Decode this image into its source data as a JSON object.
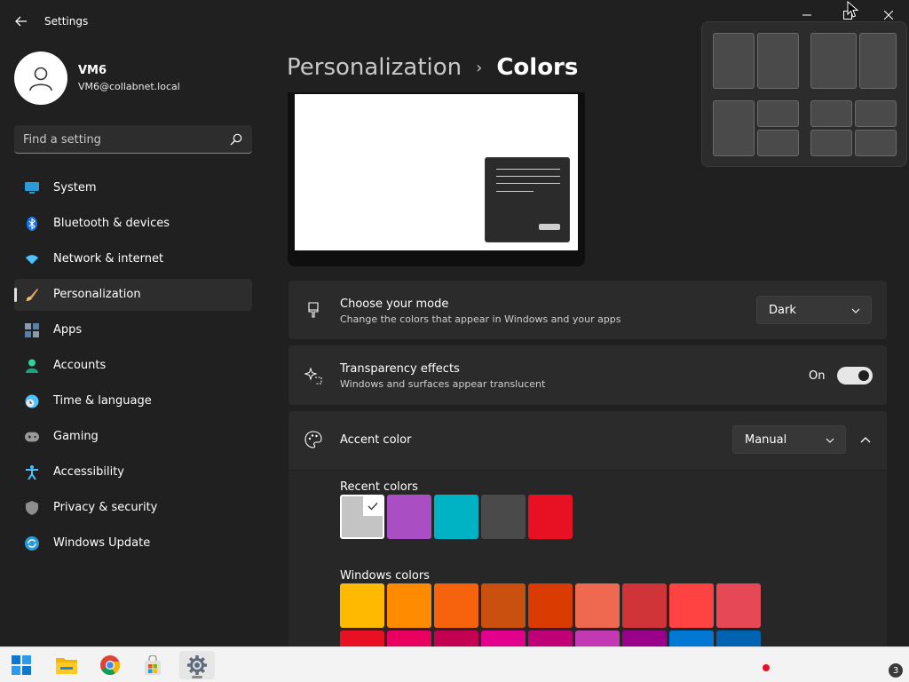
{
  "window": {
    "title": "Settings"
  },
  "user": {
    "name": "VM6",
    "email": "VM6@collabnet.local"
  },
  "search": {
    "placeholder": "Find a setting"
  },
  "sidebar": {
    "items": [
      {
        "label": "System",
        "icon": "monitor-icon",
        "active": false
      },
      {
        "label": "Bluetooth & devices",
        "icon": "bluetooth-icon",
        "active": false
      },
      {
        "label": "Network & internet",
        "icon": "wifi-icon",
        "active": false
      },
      {
        "label": "Personalization",
        "icon": "brush-icon",
        "active": true
      },
      {
        "label": "Apps",
        "icon": "apps-icon",
        "active": false
      },
      {
        "label": "Accounts",
        "icon": "person-icon",
        "active": false
      },
      {
        "label": "Time & language",
        "icon": "clock-globe-icon",
        "active": false
      },
      {
        "label": "Gaming",
        "icon": "gamepad-icon",
        "active": false
      },
      {
        "label": "Accessibility",
        "icon": "accessibility-icon",
        "active": false
      },
      {
        "label": "Privacy & security",
        "icon": "shield-icon",
        "active": false
      },
      {
        "label": "Windows Update",
        "icon": "update-icon",
        "active": false
      }
    ]
  },
  "breadcrumb": {
    "parent": "Personalization",
    "separator": "›",
    "current": "Colors"
  },
  "mode": {
    "title": "Choose your mode",
    "desc": "Change the colors that appear in Windows and your apps",
    "value": "Dark"
  },
  "transparency": {
    "title": "Transparency effects",
    "desc": "Windows and surfaces appear translucent",
    "state_label": "On",
    "on": true
  },
  "accent": {
    "title": "Accent color",
    "value": "Manual"
  },
  "recent_colors": {
    "label": "Recent colors",
    "swatches": [
      "#c4c4c4",
      "#a94fc3",
      "#00b3c4",
      "#4a4a4a",
      "#e81123"
    ],
    "selected_index": 0
  },
  "windows_colors": {
    "label": "Windows colors",
    "row1": [
      "#ffb900",
      "#ff8c00",
      "#f7630c",
      "#ca5010",
      "#da3b01",
      "#ef6950",
      "#d13438",
      "#ff4343",
      "#e74856"
    ],
    "row2": [
      "#e81123",
      "#ea005e",
      "#c30052",
      "#e3008c",
      "#bf0077",
      "#c239b3",
      "#9a0089",
      "#0078d4",
      "#0063b1"
    ]
  },
  "taskbar": {
    "items": [
      "windows-start-icon",
      "file-explorer-icon",
      "chrome-icon",
      "store-icon",
      "settings-gear-icon"
    ],
    "notification_count": "3"
  },
  "colors": {
    "background": "#202020",
    "card": "#2b2b2b",
    "taskbar": "#f3f3f3"
  }
}
